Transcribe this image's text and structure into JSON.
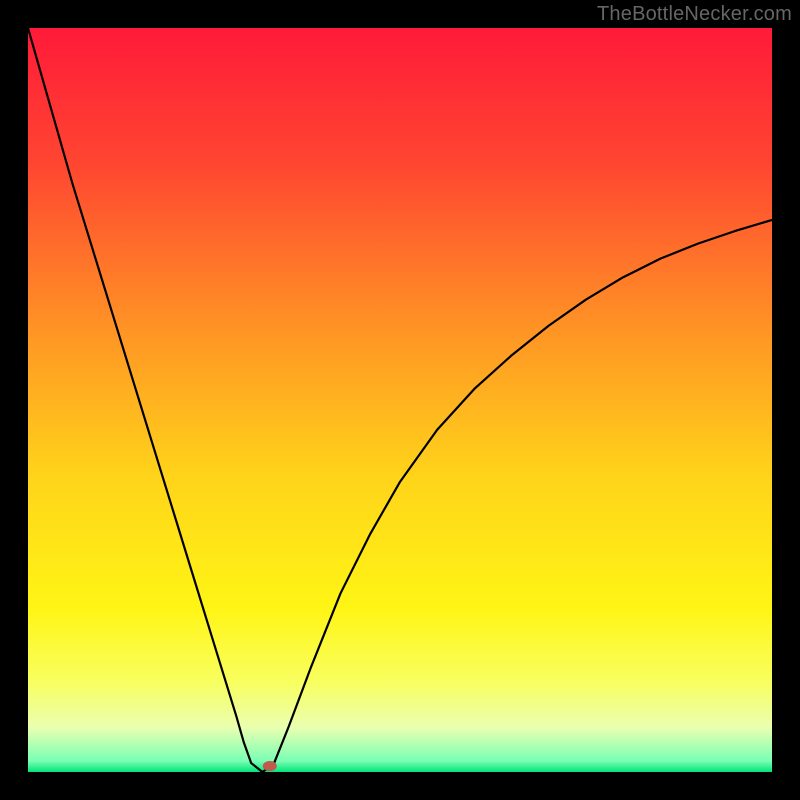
{
  "watermark": "TheBottleNecker.com",
  "chart_data": {
    "type": "line",
    "title": "",
    "xlabel": "",
    "ylabel": "",
    "xlim": [
      0,
      100
    ],
    "ylim": [
      0,
      100
    ],
    "grid": false,
    "legend": false,
    "background_gradient": {
      "stops": [
        {
          "offset": 0.0,
          "color": "#ff1a39"
        },
        {
          "offset": 0.18,
          "color": "#ff4531"
        },
        {
          "offset": 0.4,
          "color": "#ff9225"
        },
        {
          "offset": 0.6,
          "color": "#ffd31a"
        },
        {
          "offset": 0.78,
          "color": "#fff515"
        },
        {
          "offset": 0.88,
          "color": "#f8ff60"
        },
        {
          "offset": 0.94,
          "color": "#eaffb0"
        },
        {
          "offset": 0.985,
          "color": "#7affb4"
        },
        {
          "offset": 1.0,
          "color": "#00e47a"
        }
      ]
    },
    "series": [
      {
        "name": "bottleneck-curve",
        "x": [
          0.0,
          2.0,
          4.0,
          6.0,
          8.0,
          10.0,
          12.0,
          14.0,
          16.0,
          18.0,
          20.0,
          22.0,
          24.0,
          26.0,
          28.0,
          29.0,
          30.0,
          31.5,
          33.0,
          35.0,
          38.0,
          42.0,
          46.0,
          50.0,
          55.0,
          60.0,
          65.0,
          70.0,
          75.0,
          80.0,
          85.0,
          90.0,
          95.0,
          100.0
        ],
        "y": [
          100.0,
          93.0,
          86.0,
          79.0,
          72.5,
          66.0,
          59.5,
          53.0,
          46.5,
          40.0,
          33.5,
          27.0,
          20.5,
          14.0,
          7.5,
          4.0,
          1.2,
          0.0,
          1.0,
          6.0,
          14.0,
          24.0,
          32.0,
          39.0,
          46.0,
          51.5,
          56.0,
          60.0,
          63.5,
          66.5,
          69.0,
          71.0,
          72.7,
          74.2
        ]
      }
    ],
    "marker": {
      "name": "optimal-point",
      "x": 32.5,
      "y": 0.8,
      "color": "#c1594d",
      "rx": 7,
      "ry": 5
    }
  }
}
